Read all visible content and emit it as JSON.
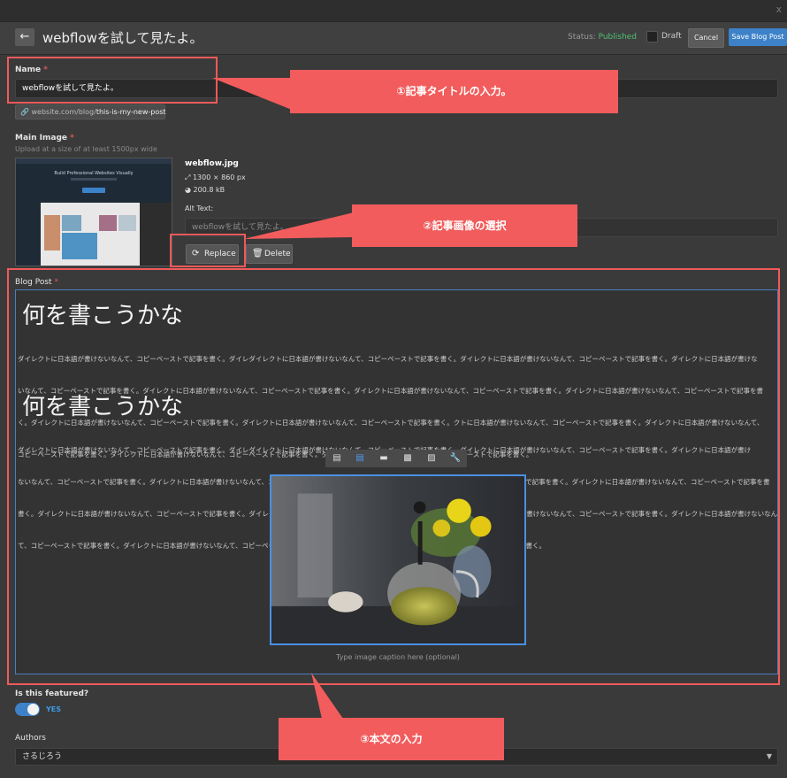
{
  "window": {
    "close_glyph": "x"
  },
  "header": {
    "back_icon": "arrow-left-icon",
    "title": "webflowを試して見たよ。",
    "status_label": "Status: ",
    "status_value": "Published",
    "status_color": "#4fbf74",
    "draft_label": "Draft",
    "cancel_label": "Cancel",
    "save_label": "Save Blog Post",
    "accent": "#3d82c9"
  },
  "name_field": {
    "label": "Name",
    "required": "*",
    "value": "webflowを試して見たよ。",
    "slug_prefix": "website.com/blog/",
    "slug": "this-is-my-new-post"
  },
  "main_image": {
    "label": "Main Image",
    "required": "*",
    "hint": "Upload at a size of at least 1500px wide",
    "filename": "webflow.jpg",
    "dimensions": "1300 × 860 px",
    "filesize": "200.8 kB",
    "alt_label": "Alt Text:",
    "alt_value": "webflowを試して見たよ。",
    "replace_label": "Replace",
    "delete_label": "Delete",
    "thumb_text": "Build Professional Websites Visually"
  },
  "blog_post": {
    "label": "Blog Post",
    "required": "*",
    "heading1": "何を書こうかな",
    "para1": [
      "ダイレクトに日本語が書けないなんて、コピーペーストで記事を書く。ダイレダイレクトに日本語が書けないなんて、コピーペーストで記事を書く。ダイレクトに日本語が書けないなんて、コピーペーストで記事を書く。ダイレクトに日本語が書けな",
      "いなんて、コピーペーストで記事を書く。ダイレクトに日本語が書けないなんて、コピーペーストで記事を書く。ダイレクトに日本語が書けないなんて、コピーペーストで記事を書く。ダイレクトに日本語が書けないなんて、コピーペーストで記事を書",
      "く。ダイレクトに日本語が書けないなんて、コピーペーストで記事を書く。ダイレクトに日本語が書けないなんて、コピーペーストで記事を書く。クトに日本語が書けないなんて、コピーペーストで記事を書く。ダイレクトに日本語が書けないなんて、",
      "コピーペーストで記事を書く。ダイレクトに日本語が書けないなんて、コピーペーストで記事を書く。ダイレクトに日本語が書けないなんて、コピーペーストで記事を書く。"
    ],
    "heading2": "何を書こうかな",
    "para2": [
      "ダイレクトに日本語が書けないなんて、コピーペーストで記事を書く。ダイレダイレクトに日本語が書けないなんて、コピーペーストで記事を書く。ダイレクトに日本語が書けないなんて、コピーペーストで記事を書く。ダイレクトに日本語が書け",
      "ないなんて、コピーペーストで記事を書く。ダイレクトに日本語が書けないなんて、コピーペーストで記事を書く。ダイレクトに日本語が書けないなんて、コピーペーストで記事を書く。ダイレクトに日本語が書けないなんて、コピーペーストで記事を書",
      "書く。ダイレクトに日本語が書けないなんて、コピーペーストで記事を書く。ダイレクトに日本語が書けないなんて、コピーペーストで記事を書く。ダイレクトに日本語が書けないなんて、コピーペーストで記事を書く。ダイレクトに日本語が書けないなん",
      "て、コピーペーストで記事を書く。ダイレクトに日本語が書けないなんて、コピーペーストで記事を書く。ダイレクトに日本語が書けないなんて、コピーペーストで記事を書く。"
    ],
    "toolbar_icons": [
      "align-left-icon",
      "align-center-icon",
      "full-width-icon",
      "float-left-icon",
      "float-right-icon",
      "wrench-icon"
    ],
    "caption_placeholder": "Type image caption here (optional)"
  },
  "featured": {
    "label": "Is this featured?",
    "toggle_value": "YES"
  },
  "authors": {
    "label": "Authors",
    "selected": "さるじろう"
  },
  "annotations": {
    "color": "#f25c5c",
    "callout1": "①記事タイトルの入力。",
    "callout2": "②記事画像の選択",
    "callout3": "③本文の入力"
  }
}
